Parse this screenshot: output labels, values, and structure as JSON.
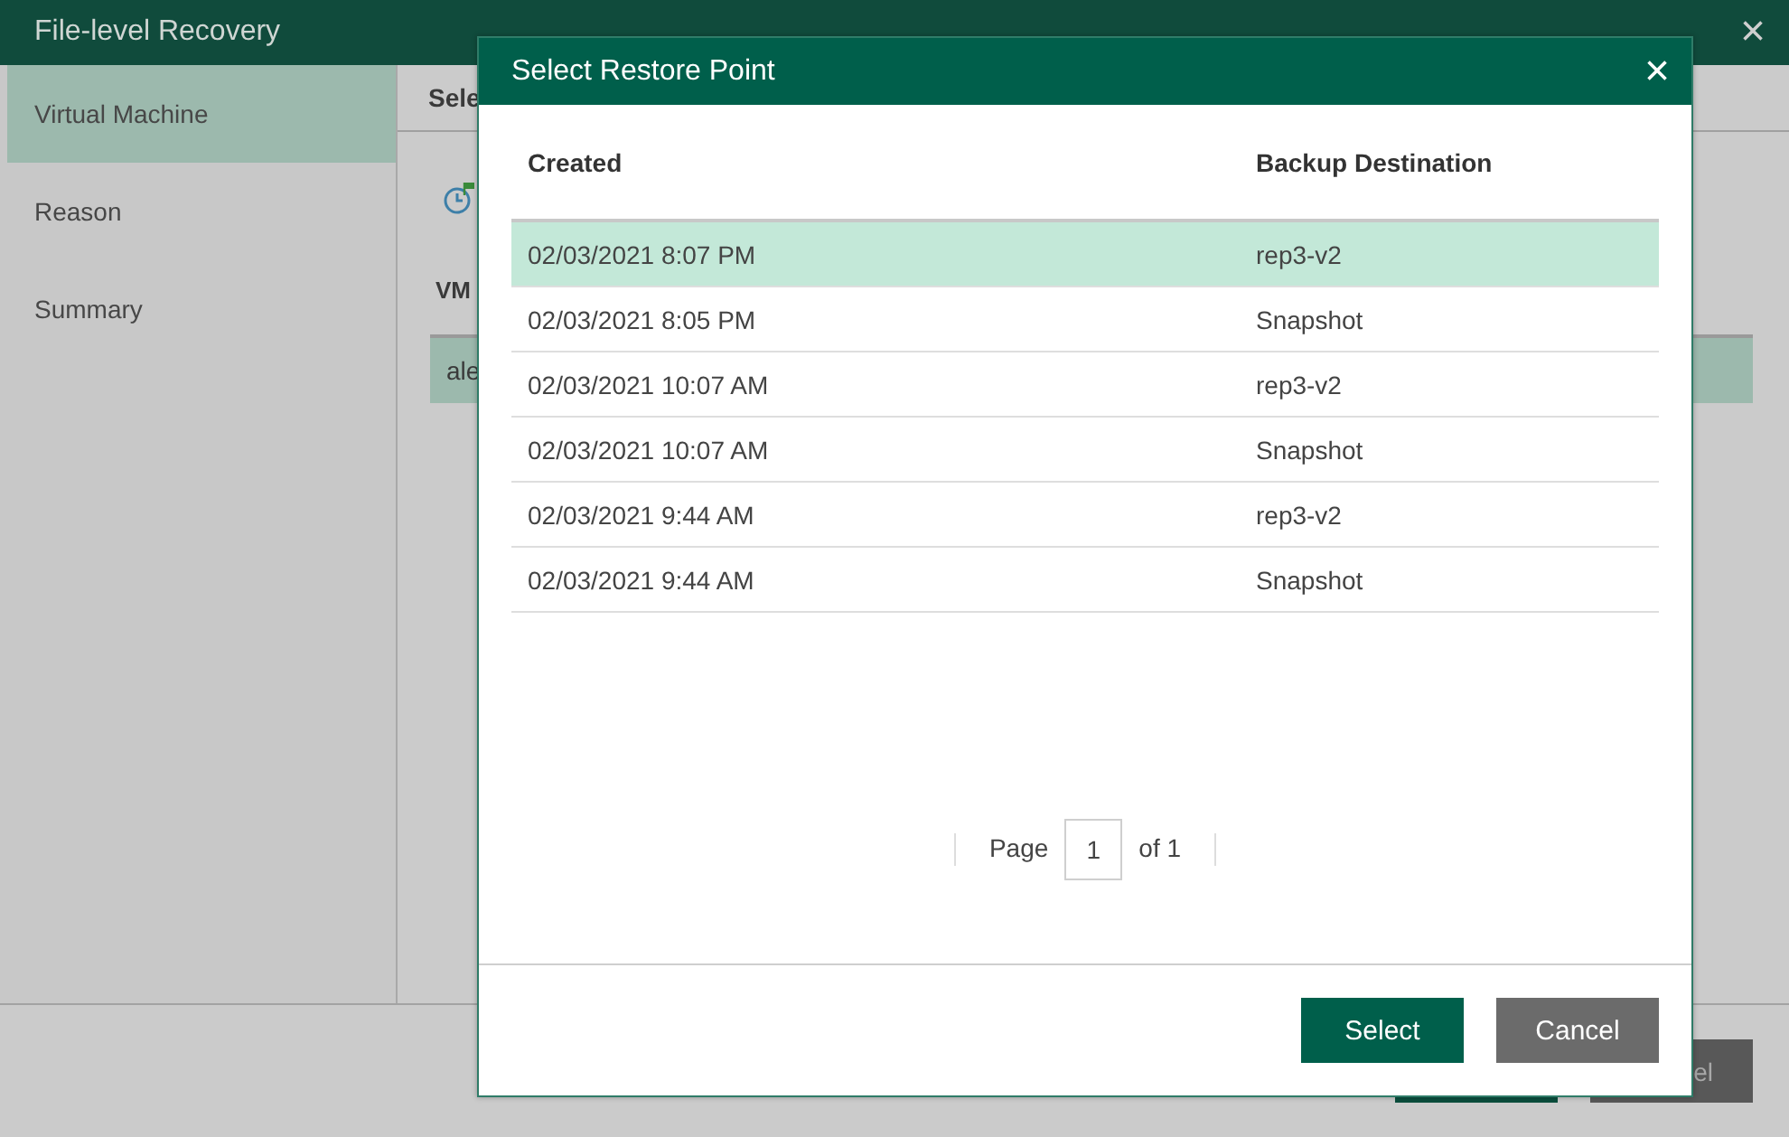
{
  "window": {
    "title": "File-level Recovery",
    "close": "×"
  },
  "sidebar": {
    "items": [
      {
        "label": "Virtual Machine",
        "selected": true
      },
      {
        "label": "Reason",
        "selected": false
      },
      {
        "label": "Summary",
        "selected": false
      }
    ]
  },
  "content": {
    "header": "Sele",
    "column_1": "VM",
    "row_1": "ale"
  },
  "footer": {
    "button_2": "el"
  },
  "dialog": {
    "title": "Select Restore Point",
    "close": "×",
    "columns": [
      "Created",
      "Backup Destination"
    ],
    "rows": [
      {
        "created": "02/03/2021 8:07 PM",
        "destination": "rep3-v2",
        "selected": true
      },
      {
        "created": "02/03/2021 8:05 PM",
        "destination": "Snapshot",
        "selected": false
      },
      {
        "created": "02/03/2021 10:07 AM",
        "destination": "rep3-v2",
        "selected": false
      },
      {
        "created": "02/03/2021 10:07 AM",
        "destination": "Snapshot",
        "selected": false
      },
      {
        "created": "02/03/2021 9:44 AM",
        "destination": "rep3-v2",
        "selected": false
      },
      {
        "created": "02/03/2021 9:44 AM",
        "destination": "Snapshot",
        "selected": false
      }
    ],
    "pager": {
      "page_label": "Page",
      "page": "1",
      "of_label": "of 1"
    },
    "buttons": [
      "Select",
      "Cancel"
    ]
  }
}
